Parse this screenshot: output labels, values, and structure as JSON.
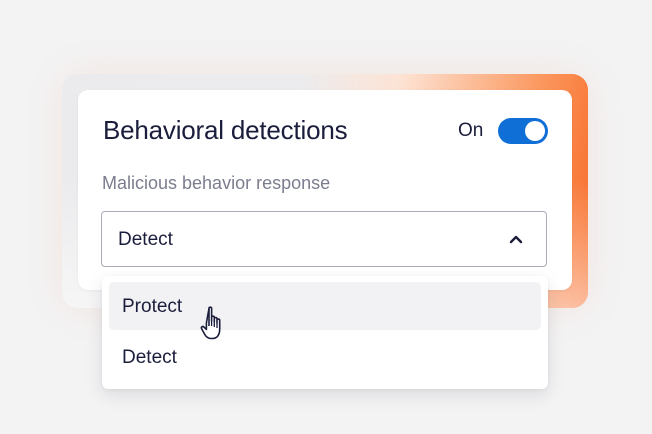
{
  "card": {
    "title": "Behavioral detections",
    "toggle": {
      "label": "On",
      "state": "on",
      "color": "#0f6fd6"
    },
    "field_label": "Malicious behavior response",
    "select": {
      "value": "Detect",
      "expanded": true,
      "icon": "chevron-up-icon"
    }
  },
  "dropdown": {
    "options": [
      {
        "label": "Protect",
        "hovered": true
      },
      {
        "label": "Detect",
        "hovered": false
      }
    ]
  },
  "cursor": {
    "icon": "hand-pointer-icon"
  },
  "colors": {
    "accent_glow": "#f76a26",
    "text_primary": "#1b1d3c",
    "text_secondary": "#7b7d8e"
  }
}
